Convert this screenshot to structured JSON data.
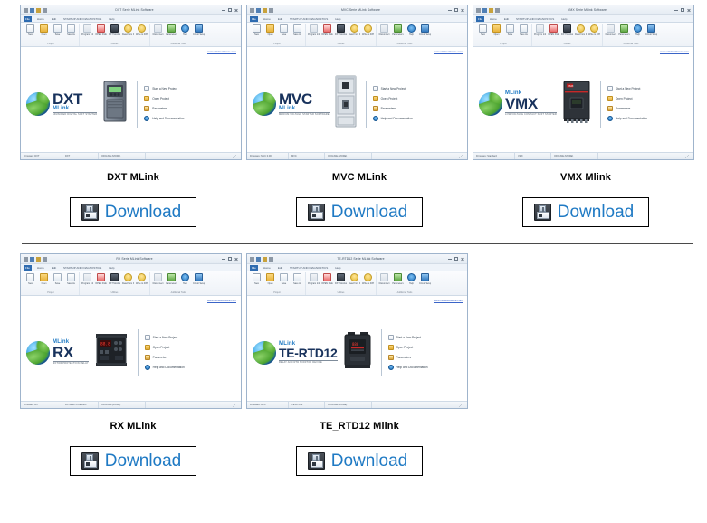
{
  "page": {
    "download_label": "Download",
    "download_icon": "floppy-disk-save-icon"
  },
  "window_chrome": {
    "tabs": [
      "File",
      "Home",
      "Edit",
      "STARTUP AND DIAGNOSTICS",
      "Help"
    ],
    "active_tab": "File",
    "quick_access_icons": [
      "save-icon",
      "undo-icon",
      "redo-icon",
      "customize-icon"
    ],
    "controls": [
      "minimize-button",
      "restore-button",
      "maximize-button",
      "close-button"
    ],
    "ribbon_groups": [
      {
        "name": "Project",
        "buttons": [
          {
            "label": "New",
            "icon": "new-document-icon"
          },
          {
            "label": "Open",
            "icon": "open-folder-icon"
          },
          {
            "label": "Save",
            "icon": "save-list-icon"
          },
          {
            "label": "Save As",
            "icon": "save-as-icon"
          }
        ]
      },
      {
        "name": "Utilities",
        "buttons": [
          {
            "label": "Program Info",
            "icon": "program-info-icon"
          },
          {
            "label": "OPEN FILE",
            "icon": "chart-icon"
          },
          {
            "label": "DXT Monitor",
            "icon": "monitor-icon"
          },
          {
            "label": "Read from DXT",
            "icon": "read-bulb-icon"
          },
          {
            "label": "Write to DXT",
            "icon": "write-bulb-icon"
          }
        ]
      },
      {
        "name": "Additional Tools",
        "buttons": [
          {
            "label": "Disconnect",
            "icon": "disconnect-icon"
          },
          {
            "label": "Parameters",
            "icon": "parameters-icon"
          },
          {
            "label": "Help",
            "icon": "help-info-icon"
          },
          {
            "label": "Circuit Setup",
            "icon": "circuit-setup-icon"
          }
        ]
      }
    ],
    "weblink": "www.mlinksoftware.com",
    "menu_items": [
      {
        "label": "Start a New Project",
        "icon": "new-page-icon"
      },
      {
        "label": "Open Project",
        "icon": "open-folder-icon"
      },
      {
        "label": "Parameters",
        "icon": "parameters-icon"
      },
      {
        "label": "Help and Documentation",
        "icon": "help-info-icon"
      }
    ]
  },
  "products": [
    {
      "caption": "DXT MLink",
      "window_title": "DXT Serie MLink Software",
      "brand_pre": "",
      "brand_main": "DXT",
      "brand_sub": "MLink",
      "brand_tagline": "ADVANCED DIGITAL SOFT STARTER",
      "device": "dxt-soft-starter-device",
      "status": [
        "Firmware: DXT",
        "DXT",
        "OFFLINE  (MODE)"
      ]
    },
    {
      "caption": "MVC MLink",
      "window_title": "MVC Serie MLink Software",
      "brand_pre": "",
      "brand_main": "MVC",
      "brand_sub": "MLink",
      "brand_tagline": "MEDIUM VOLTAGE STARTER SOFTWARE",
      "device": "mvc-switchgear-cabinet-device",
      "status": [
        "Firmware: MVC 0.00",
        "MVC",
        "OFFLINE  (MODE)"
      ]
    },
    {
      "caption": "VMX Mlink",
      "window_title": "VMX Serie MLink Software",
      "brand_pre": "MLink",
      "brand_main": "VMX",
      "brand_sub": "",
      "brand_tagline": "LOW VOLTAGE COMPACT SOFT STARTER",
      "device": "vmx-compact-soft-starter-device",
      "status": [
        "Firmware: Standard",
        "VMX",
        "OFFLINE  (MODE)"
      ]
    },
    {
      "caption": "RX MLink",
      "window_title": "RX Serie MLink Software",
      "brand_pre": "MLink",
      "brand_main": "RX",
      "brand_sub": "",
      "brand_tagline": "MOTOR PROTECTION RELAY",
      "device": "rx-motor-protection-relay-device",
      "status": [
        "Firmware: RX",
        "RX Motor Protection",
        "OFFLINE  (MODE)"
      ]
    },
    {
      "caption": "TE_RTD12 Mlink",
      "window_title": "TE-RTD12 Serie MLink Software",
      "brand_pre": "MLink",
      "brand_main": "TE-RTD12",
      "brand_sub": "",
      "brand_tagline": "RELAY AND RTD MONITOR DEVICE",
      "device": "te-rtd12-relay-monitor-device",
      "status": [
        "Firmware: RTD",
        "TE-RTD12",
        "OFFLINE  (MODE)"
      ]
    }
  ],
  "colors": {
    "brand_dark": "#18325c",
    "brand_blue": "#1f7ac4",
    "link_blue": "#3a64c8",
    "ribbon_active": "#2e6bb0"
  }
}
